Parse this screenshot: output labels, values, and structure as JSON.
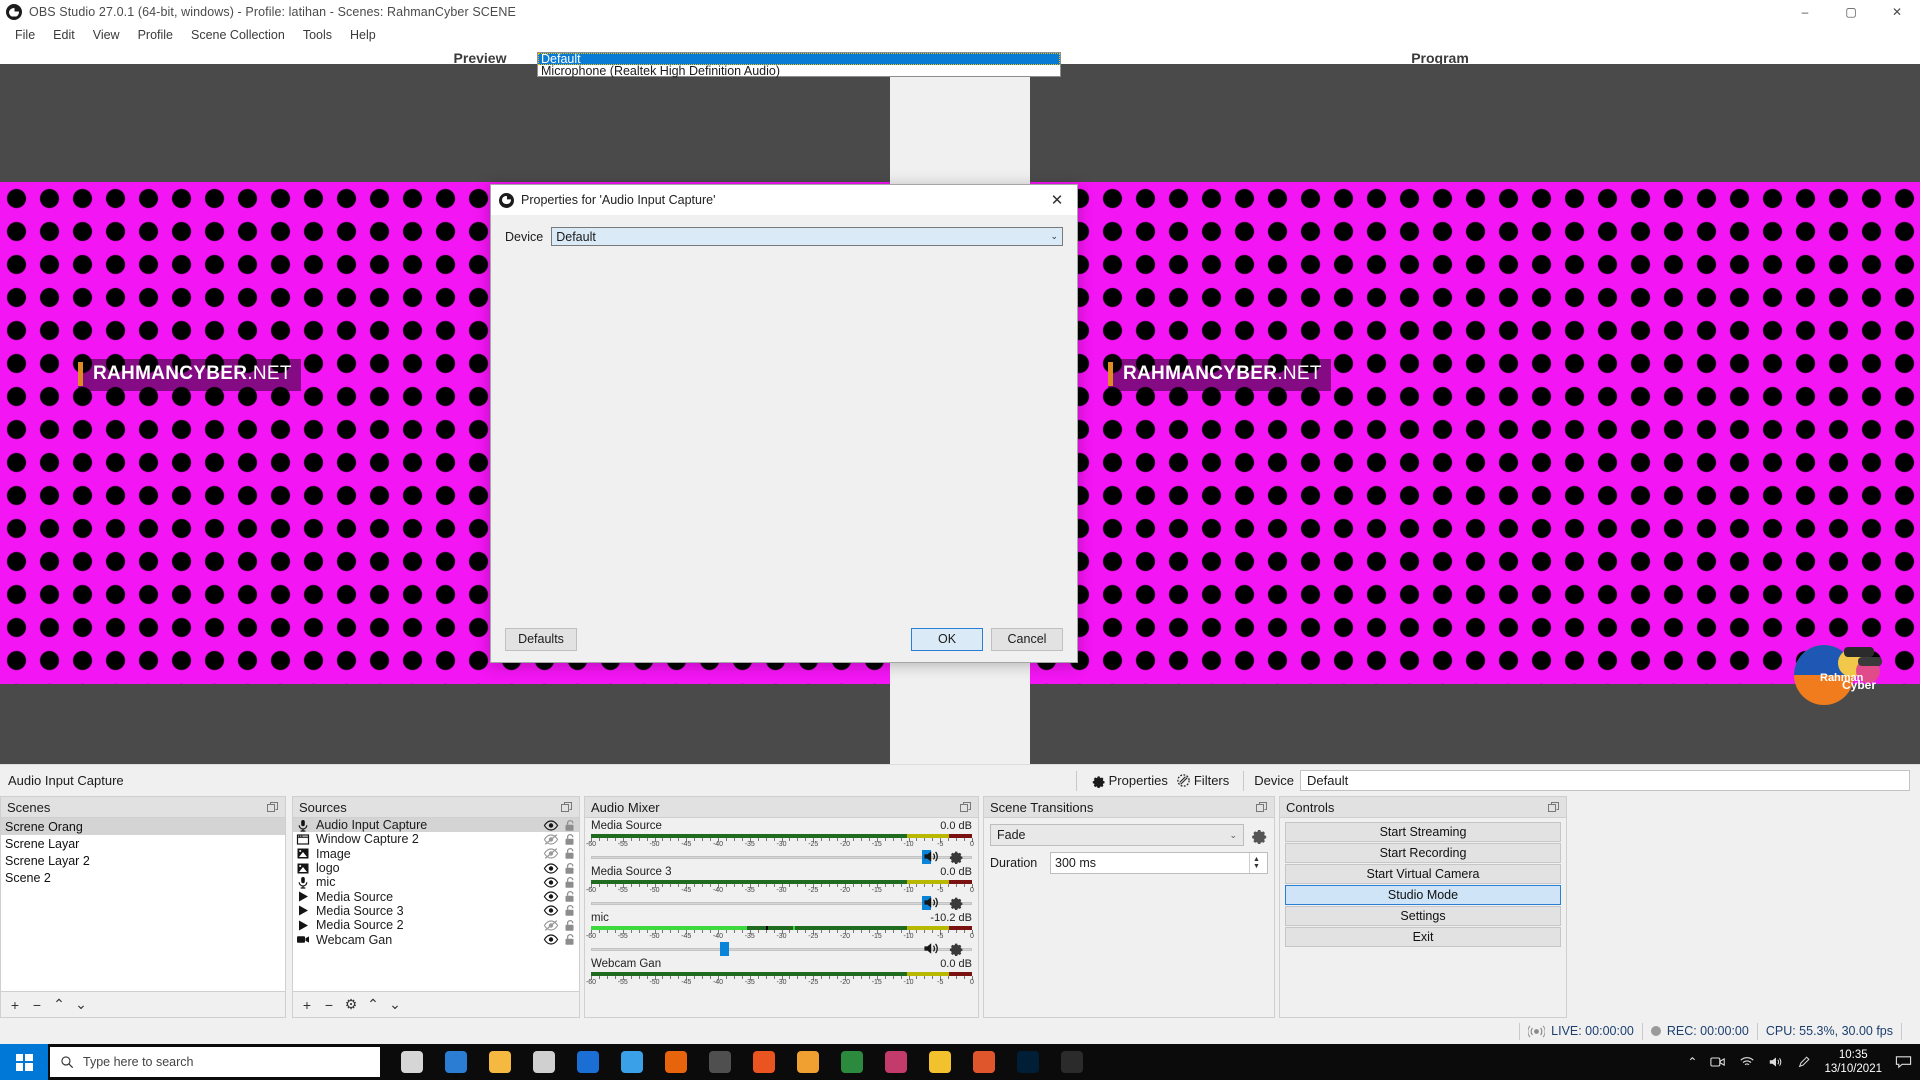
{
  "window": {
    "title": "OBS Studio 27.0.1 (64-bit, windows) - Profile: latihan - Scenes: RahmanCyber SCENE",
    "minimize": "–",
    "maximize": "▢",
    "close": "✕"
  },
  "menu": [
    "File",
    "Edit",
    "View",
    "Profile",
    "Scene Collection",
    "Tools",
    "Help"
  ],
  "stage": {
    "preview_label": "Preview",
    "program_label": "Program",
    "watermark_main": "RAHMANCYBER",
    "watermark_suffix": ".NET",
    "logo_text": "RahmanCyber"
  },
  "source_toolbar": {
    "source_name": "Audio Input Capture",
    "properties_label": "Properties",
    "filters_label": "Filters",
    "device_label": "Device",
    "device_value": "Default"
  },
  "scenes": {
    "title": "Scenes",
    "items": [
      {
        "label": "Screne Orang",
        "selected": true
      },
      {
        "label": "Screne Layar",
        "selected": false
      },
      {
        "label": "Screne Layar 2",
        "selected": false
      },
      {
        "label": "Scene 2",
        "selected": false
      }
    ],
    "footer": {
      "add": "+",
      "remove": "−",
      "up": "⌃",
      "down": "⌄"
    }
  },
  "sources": {
    "title": "Sources",
    "items": [
      {
        "label": "Audio Input Capture",
        "icon": "microphone-icon",
        "visible": true,
        "locked": false,
        "selected": true
      },
      {
        "label": "Window Capture 2",
        "icon": "window-icon",
        "visible": false,
        "locked": false,
        "selected": false
      },
      {
        "label": "Image",
        "icon": "image-icon",
        "visible": false,
        "locked": false,
        "selected": false
      },
      {
        "label": "logo",
        "icon": "image-icon",
        "visible": true,
        "locked": false,
        "selected": false
      },
      {
        "label": "mic",
        "icon": "microphone-icon",
        "visible": true,
        "locked": false,
        "selected": false
      },
      {
        "label": "Media Source",
        "icon": "media-icon",
        "visible": true,
        "locked": false,
        "selected": false
      },
      {
        "label": "Media Source 3",
        "icon": "media-icon",
        "visible": true,
        "locked": false,
        "selected": false
      },
      {
        "label": "Media Source 2",
        "icon": "media-icon",
        "visible": false,
        "locked": false,
        "selected": false
      },
      {
        "label": "Webcam Gan",
        "icon": "camera-icon",
        "visible": true,
        "locked": false,
        "selected": false
      }
    ],
    "footer": {
      "add": "+",
      "remove": "−",
      "settings": "⚙",
      "up": "⌃",
      "down": "⌄"
    }
  },
  "mixer": {
    "title": "Audio Mixer",
    "scale_labels": [
      "-60",
      "-55",
      "-50",
      "-45",
      "-40",
      "-35",
      "-30",
      "-25",
      "-20",
      "-15",
      "-10",
      "-5",
      "0"
    ],
    "tracks": [
      {
        "name": "Media Source",
        "db": "0.0 dB",
        "level_pct": 0,
        "bright_pct": 0,
        "slider_pct": 88,
        "muted": false
      },
      {
        "name": "Media Source 3",
        "db": "0.0 dB",
        "level_pct": 0,
        "bright_pct": 0,
        "slider_pct": 88,
        "muted": false
      },
      {
        "name": "mic",
        "db": "-10.2 dB",
        "level_pct": 100,
        "bright_pct": 41,
        "slider_pct": 35,
        "muted": false
      },
      {
        "name": "Webcam Gan",
        "db": "0.0 dB",
        "level_pct": 0,
        "bright_pct": 0,
        "slider_pct": 88,
        "muted": false
      }
    ]
  },
  "transitions": {
    "title": "Scene Transitions",
    "current": "Fade",
    "duration_label": "Duration",
    "duration_value": "300 ms",
    "chevron": "⌄",
    "spin_up": "▲",
    "spin_down": "▼"
  },
  "controls": {
    "title": "Controls",
    "buttons": [
      {
        "label": "Start Streaming",
        "active": false
      },
      {
        "label": "Start Recording",
        "active": false
      },
      {
        "label": "Start Virtual Camera",
        "active": false
      },
      {
        "label": "Studio Mode",
        "active": true
      },
      {
        "label": "Settings",
        "active": false
      },
      {
        "label": "Exit",
        "active": false
      }
    ]
  },
  "statusbar": {
    "live": "LIVE: 00:00:00",
    "rec": "REC: 00:00:00",
    "cpu": "CPU: 55.3%, 30.00 fps"
  },
  "dialog": {
    "title": "Properties for 'Audio Input Capture'",
    "close": "✕",
    "device_label": "Device",
    "device_value": "Default",
    "chevron": "⌄",
    "options": [
      {
        "label": "Default",
        "selected": true
      },
      {
        "label": "Microphone (Realtek High Definition Audio)",
        "selected": false
      }
    ],
    "defaults_label": "Defaults",
    "ok_label": "OK",
    "cancel_label": "Cancel"
  },
  "taskbar": {
    "search_placeholder": "Type here to search",
    "clock_time": "10:35",
    "clock_date": "13/10/2021",
    "apps": [
      {
        "name": "task-view-icon",
        "color": "#d6d6d6"
      },
      {
        "name": "edge-icon",
        "color": "#2b7cd3"
      },
      {
        "name": "file-explorer-icon",
        "color": "#f5b942"
      },
      {
        "name": "store-icon",
        "color": "#d0d0d0"
      },
      {
        "name": "mail-icon",
        "color": "#1b6fd4"
      },
      {
        "name": "onedrive-icon",
        "color": "#3aa0e8"
      },
      {
        "name": "vlc-icon",
        "color": "#e8640c"
      },
      {
        "name": "movie-maker-icon",
        "color": "#4f4f4f"
      },
      {
        "name": "firefox-icon",
        "color": "#e95420"
      },
      {
        "name": "wmp-icon",
        "color": "#f0a030"
      },
      {
        "name": "chrome-icon",
        "color": "#2b8a3e"
      },
      {
        "name": "paint-icon",
        "color": "#c23b6a"
      },
      {
        "name": "notepad-icon",
        "color": "#f2c12e"
      },
      {
        "name": "chrome-canary-icon",
        "color": "#e0562c"
      },
      {
        "name": "photoshop-icon",
        "color": "#001e36"
      },
      {
        "name": "obs-icon",
        "color": "#2b2b2b"
      }
    ],
    "tray": {
      "chevron": "⌃",
      "meet": "⧉",
      "wifi": "⌁",
      "volume": "🔊",
      "pen": "✎",
      "notify": "▭"
    }
  },
  "colors": {
    "accent": "#0a7bd4",
    "magenta": "#f315f3",
    "chrome": "#f0f0f0",
    "dock_title": "#e1e1e1",
    "meter_green": "#1f6b1f",
    "meter_bright": "#3ed93e"
  }
}
